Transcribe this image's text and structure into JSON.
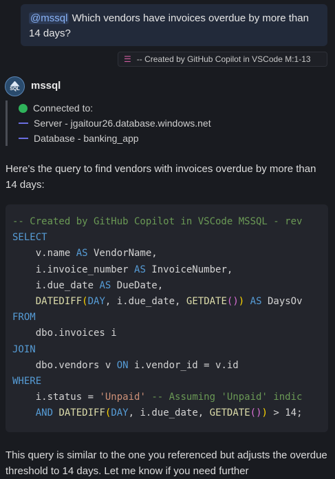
{
  "user_message": {
    "mention": "@mssql",
    "text": " Which vendors have invoices overdue by more than 14 days?"
  },
  "reference": {
    "icon": "database-icon",
    "label": "-- Created by GitHub Copilot in VSCode M:1-13"
  },
  "bot": {
    "name": "mssql",
    "avatar_label": "SQL"
  },
  "connection": {
    "status": "Connected to:",
    "server": "Server - jgaitour26.database.windows.net",
    "database": "Database - banking_app"
  },
  "intro_text": "Here's the query to find vendors with invoices overdue by more than 14 days:",
  "code": {
    "lines": [
      "-- Created by GitHub Copilot in VSCode MSSQL - rev",
      "SELECT",
      "    v.name AS VendorName,",
      "    i.invoice_number AS InvoiceNumber,",
      "    i.due_date AS DueDate,",
      "    DATEDIFF(DAY, i.due_date, GETDATE()) AS DaysOv",
      "FROM",
      "    dbo.invoices i",
      "JOIN",
      "    dbo.vendors v ON i.vendor_id = v.id",
      "WHERE",
      "    i.status = 'Unpaid' -- Assuming 'Unpaid' indic",
      "    AND DATEDIFF(DAY, i.due_date, GETDATE()) > 14;"
    ]
  },
  "outro_text": "This query is similar to the one you referenced but adjusts the overdue threshold to 14 days. Let me know if you need further",
  "colors": {
    "background": "#191b20",
    "keyword": "#569cd6",
    "comment": "#6a9955",
    "function": "#dcdcaa",
    "string": "#ce9178",
    "connected": "#2fb35b"
  }
}
